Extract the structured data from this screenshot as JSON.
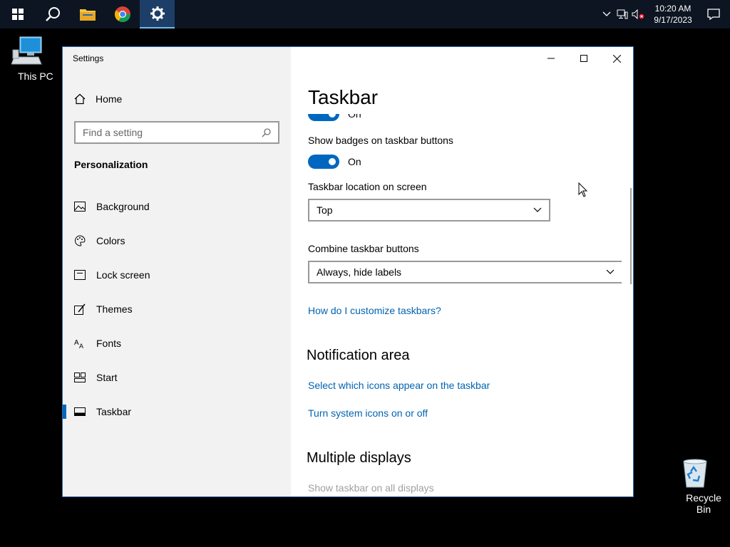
{
  "taskbar": {
    "clock_time": "10:20 AM",
    "clock_date": "9/17/2023"
  },
  "desktop": {
    "this_pc": "This PC",
    "recycle_bin": "Recycle Bin"
  },
  "window": {
    "title": "Settings"
  },
  "sidebar": {
    "home": "Home",
    "search_placeholder": "Find a setting",
    "section": "Personalization",
    "items": [
      {
        "label": "Background"
      },
      {
        "label": "Colors"
      },
      {
        "label": "Lock screen"
      },
      {
        "label": "Themes"
      },
      {
        "label": "Fonts"
      },
      {
        "label": "Start"
      },
      {
        "label": "Taskbar"
      }
    ]
  },
  "content": {
    "title": "Taskbar",
    "partial_toggle_state": "On",
    "badges_label": "Show badges on taskbar buttons",
    "badges_state": "On",
    "location_label": "Taskbar location on screen",
    "location_value": "Top",
    "combine_label": "Combine taskbar buttons",
    "combine_value": "Always, hide labels",
    "customize_link": "How do I customize taskbars?",
    "notification_heading": "Notification area",
    "select_icons_link": "Select which icons appear on the taskbar",
    "system_icons_link": "Turn system icons on or off",
    "multiple_heading": "Multiple displays",
    "show_all_label": "Show taskbar on all displays"
  },
  "colors": {
    "accent": "#0067c0",
    "link": "#0063b1",
    "taskbar": "#0c1521"
  }
}
